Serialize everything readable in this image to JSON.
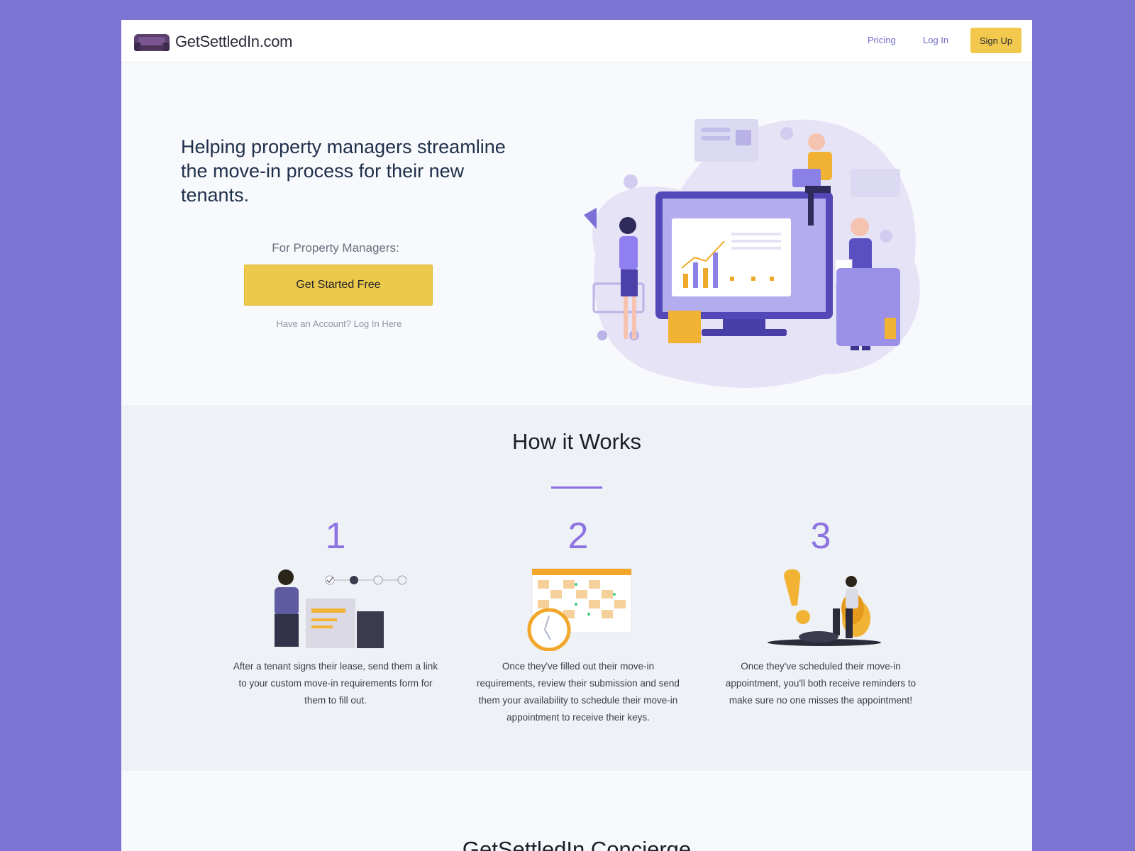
{
  "header": {
    "logo_text": "GetSettledIn.com",
    "nav": {
      "pricing": "Pricing",
      "login": "Log In",
      "signup": "Sign Up"
    }
  },
  "hero": {
    "title": "Helping property managers streamline the move-in process for their new tenants.",
    "for_label": "For Property Managers:",
    "cta": "Get Started Free",
    "login_link": "Have an Account? Log In Here"
  },
  "how": {
    "title": "How it Works",
    "steps": [
      {
        "number": "1",
        "text": "After a tenant signs their lease, send them a link to your custom move-in requirements form for them to fill out."
      },
      {
        "number": "2",
        "text": "Once they've filled out their move-in requirements, review their submission and send them your availability to schedule their move-in appointment to receive their keys."
      },
      {
        "number": "3",
        "text": "Once they've scheduled their move-in appointment, you'll both receive reminders to make sure no one misses the appointment!"
      }
    ]
  },
  "next_section": {
    "title": "GetSettledIn Concierge"
  },
  "colors": {
    "background": "#7c74d3",
    "accent": "#8d72e1",
    "cta": "#ecc94b",
    "nav_link": "#6f6bc8"
  }
}
